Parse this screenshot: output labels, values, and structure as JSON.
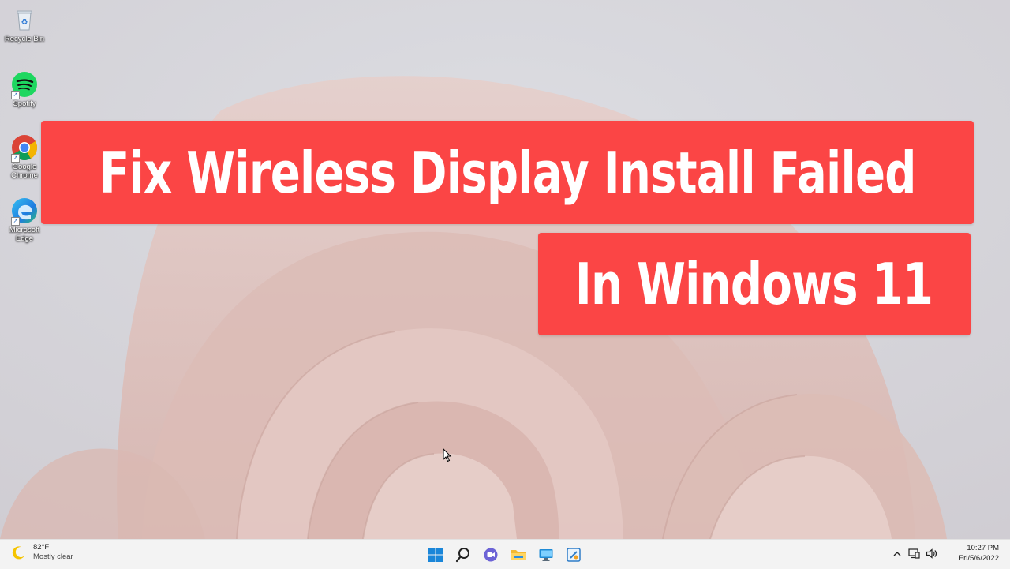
{
  "desktop": {
    "icons": [
      {
        "label": "Recycle Bin",
        "icon": "recycle-bin-icon"
      },
      {
        "label": "Spotify",
        "icon": "spotify-icon"
      },
      {
        "label": "Google Chrome",
        "icon": "chrome-icon"
      },
      {
        "label": "Microsoft Edge",
        "icon": "edge-icon"
      }
    ]
  },
  "banner": {
    "line1": "Fix Wireless Display Install Failed",
    "line2": "In Windows 11",
    "color": "#fb4545"
  },
  "taskbar": {
    "weather": {
      "temp": "82°F",
      "condition": "Mostly clear",
      "icon": "moon-icon"
    },
    "pinned": [
      "start-icon",
      "search-icon",
      "teams-chat-icon",
      "file-explorer-icon",
      "desktop-monitor-icon",
      "control-panel-icon"
    ],
    "tray": [
      "chevron-up-icon",
      "network-icon",
      "volume-icon"
    ],
    "clock": {
      "time": "10:27 PM",
      "date": "Fri/5/6/2022"
    }
  }
}
